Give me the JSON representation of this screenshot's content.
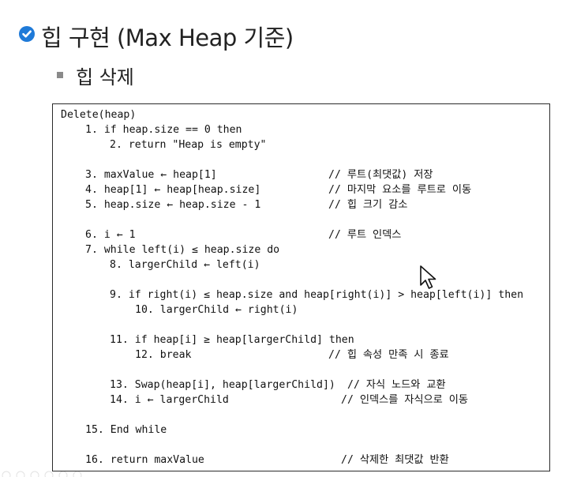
{
  "heading": {
    "title": "힙 구현 (Max Heap 기준)",
    "subtitle": "힙 삭제"
  },
  "code": {
    "header": "Delete(heap)",
    "lines": [
      "1. if heap.size == 0 then",
      "2. return \"Heap is empty\"",
      "3. maxValue ← heap[1]",
      "4. heap[1] ← heap[heap.size]",
      "5. heap.size ← heap.size - 1",
      "6. i ← 1",
      "7. while left(i) ≤ heap.size do",
      "8. largerChild ← left(i)",
      "9. if right(i) ≤ heap.size and heap[right(i)] > heap[left(i)] then",
      "10. largerChild ← right(i)",
      "11. if heap[i] ≥ heap[largerChild] then",
      "12. break",
      "13. Swap(heap[i], heap[largerChild])",
      "14. i ← largerChild",
      "15. End while",
      "16. return maxValue"
    ],
    "comments": [
      "// 루트(최댓값) 저장",
      "// 마지막 요소를 루트로 이동",
      "// 힙 크기 감소",
      "// 루트 인덱스",
      "// 힙 속성 만족 시 종료",
      "// 자식 노드와 교환",
      "// 인덱스를 자식으로 이동",
      "// 삭제한 최댓값 반환"
    ]
  },
  "icons": {
    "bullet": "check-circle-icon",
    "cursor": "mouse-pointer-icon"
  },
  "colors": {
    "bullet": "#1f7ad8",
    "text": "#222222"
  }
}
